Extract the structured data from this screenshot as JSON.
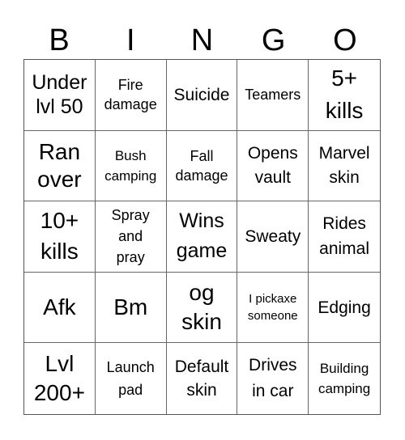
{
  "header": {
    "letters": [
      "B",
      "I",
      "N",
      "G",
      "O"
    ]
  },
  "card": {
    "cells": [
      "Under\nlvl 50",
      "Fire\ndamage",
      "Suicide",
      "Teamers",
      "5+\nkills",
      "Ran\nover",
      "Bush\ncamping",
      "Fall\ndamage",
      "Opens\nvault",
      "Marvel\nskin",
      "10+\nkills",
      "Spray\nand\npray",
      "Wins\ngame",
      "Sweaty",
      "Rides\nanimal",
      "Afk",
      "Bm",
      "og\nskin",
      "I pickaxe\nsomeone",
      "Edging",
      "Lvl\n200+",
      "Launch\npad",
      "Default\nskin",
      "Drives\nin car",
      "Building\ncamping"
    ]
  }
}
